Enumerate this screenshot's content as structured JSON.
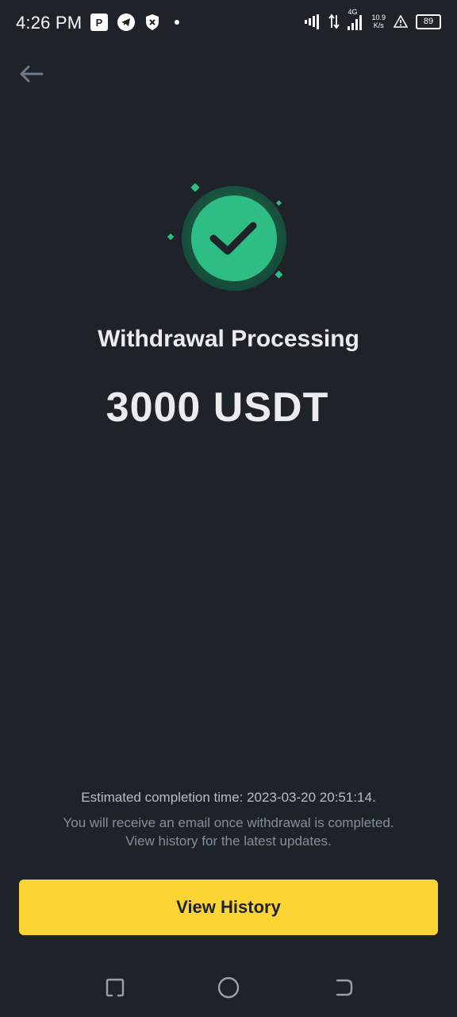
{
  "status_bar": {
    "time": "4:26 PM",
    "network_label": "4G",
    "speed_value": "10.9",
    "speed_unit": "K/s",
    "battery": "89",
    "icons": [
      "parking-app-icon",
      "telegram-icon",
      "shield-x-icon",
      "notification-dot-icon",
      "signal-icon",
      "data-arrows-icon",
      "signal-4g-icon",
      "speed-indicator",
      "warning-icon",
      "battery-icon"
    ]
  },
  "header": {
    "back_icon": "back-arrow-icon"
  },
  "result": {
    "status_icon": "success-check-icon",
    "title": "Withdrawal Processing",
    "amount": "3000 USDT"
  },
  "info": {
    "eta": "Estimated completion time: 2023-03-20 20:51:14.",
    "note_line1": "You will receive an email once withdrawal is completed.",
    "note_line2": "View history for the latest updates."
  },
  "actions": {
    "view_history_label": "View History"
  },
  "nav_bar": {
    "icons": [
      "recents-icon",
      "home-icon",
      "back-icon"
    ]
  },
  "colors": {
    "background": "#1e2329",
    "accent_green": "#2ebd85",
    "button_yellow": "#fcd535",
    "text_primary": "#eaecef",
    "text_secondary": "#848e9c"
  }
}
